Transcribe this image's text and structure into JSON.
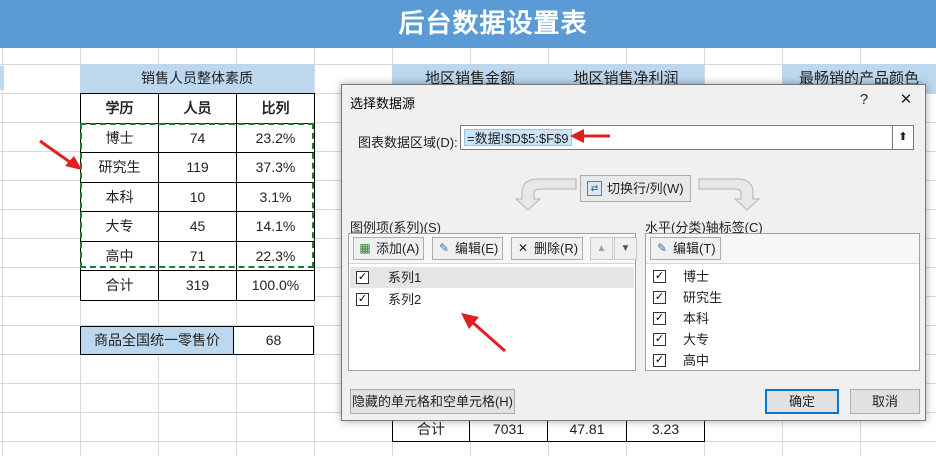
{
  "sheet": {
    "banner_title": "后台数据设置表",
    "quality_header": "销售人员整体素质",
    "quality_columns": [
      "学历",
      "人员",
      "比列"
    ],
    "quality_rows": [
      {
        "edu": "博士",
        "count": "74",
        "ratio": "23.2%"
      },
      {
        "edu": "研究生",
        "count": "119",
        "ratio": "37.3%"
      },
      {
        "edu": "本科",
        "count": "10",
        "ratio": "3.1%"
      },
      {
        "edu": "大专",
        "count": "45",
        "ratio": "14.1%"
      },
      {
        "edu": "高中",
        "count": "71",
        "ratio": "22.3%"
      },
      {
        "edu": "合计",
        "count": "319",
        "ratio": "100.0%"
      }
    ],
    "price_label": "商品全国统一零售价",
    "price_value": "68",
    "region_headers": [
      "地区销售金额",
      "地区销售净利润",
      "最畅销的产品颜色"
    ],
    "bottom_row": [
      "合计",
      "7031",
      "47.81",
      "3.23"
    ]
  },
  "dialog": {
    "title": "选择数据源",
    "help": "?",
    "close": "✕",
    "range_label": "图表数据区域(D):",
    "range_value": "=数据!$D$5:$F$9",
    "collapse_icon": "collapse-range-icon",
    "switch_label": "切换行/列(W)",
    "legend_section": "图例项(系列)(S)",
    "axis_section": "水平(分类)轴标签(C)",
    "legend_toolbar": {
      "add": "添加(A)",
      "edit": "编辑(E)",
      "delete": "删除(R)"
    },
    "axis_toolbar": {
      "edit": "编辑(T)"
    },
    "series": [
      {
        "label": "系列1",
        "checked": true
      },
      {
        "label": "系列2",
        "checked": true
      }
    ],
    "categories": [
      {
        "label": "博士",
        "checked": true
      },
      {
        "label": "研究生",
        "checked": true
      },
      {
        "label": "本科",
        "checked": true
      },
      {
        "label": "大专",
        "checked": true
      },
      {
        "label": "高中",
        "checked": true
      }
    ],
    "hidden_cells_button": "隐藏的单元格和空单元格(H)",
    "ok_button": "确定",
    "cancel_button": "取消"
  },
  "colors": {
    "banner": "#5b9bd5",
    "header_fill": "#bdd7ee",
    "annotation_arrow": "#e02020",
    "selection_marquee": "#1e7b34",
    "dialog_accent": "#0078d7"
  }
}
